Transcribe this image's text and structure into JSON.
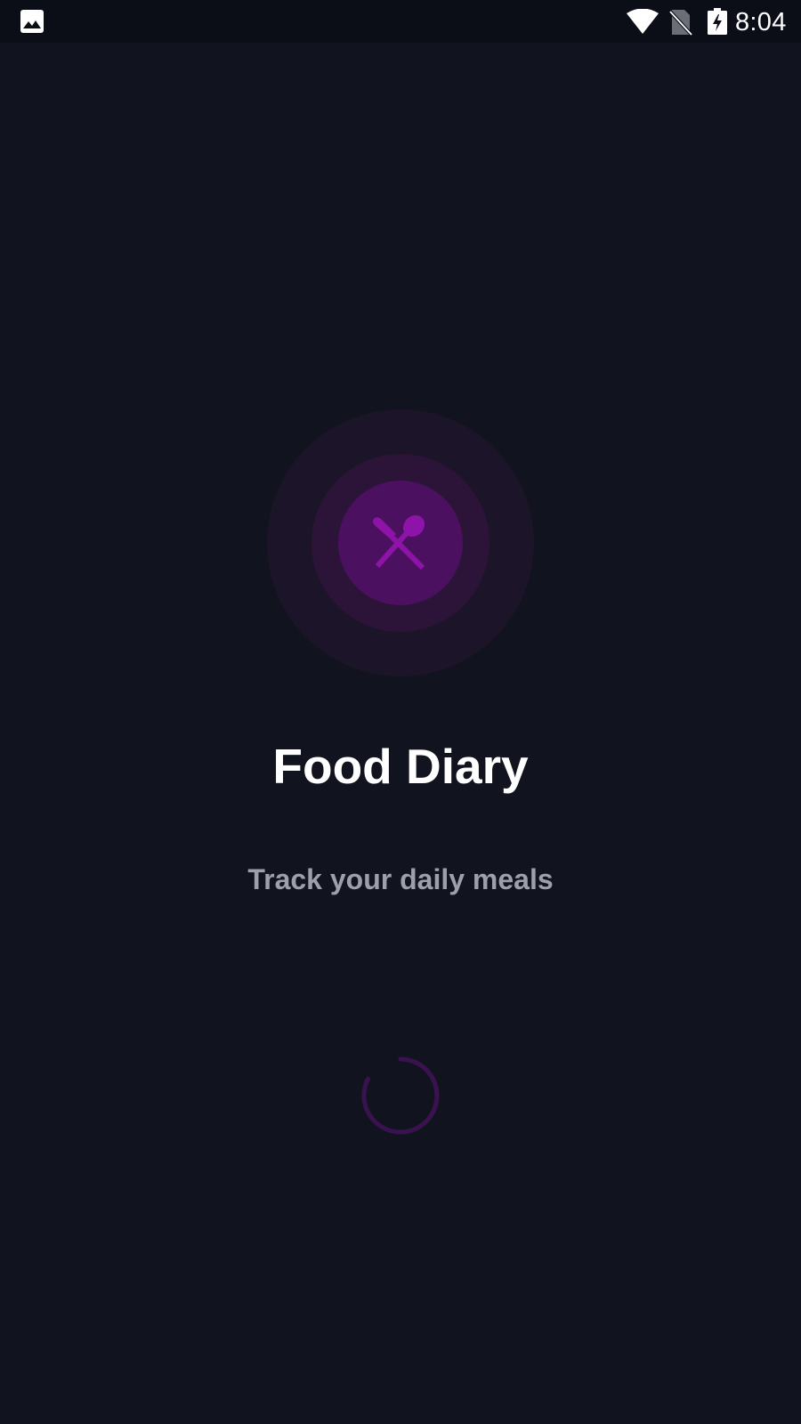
{
  "status_bar": {
    "time": "8:04",
    "icons": [
      "gallery-icon",
      "wifi-icon",
      "no-sim-icon",
      "battery-charging-icon"
    ]
  },
  "splash": {
    "logo_icon": "cutlery-icon",
    "title": "Food Diary",
    "subtitle": "Track your daily meals",
    "loading_indicator": "spinner"
  },
  "colors": {
    "background": "#11141e",
    "status_bar_bg": "#0b0e17",
    "accent": "#8e13a8",
    "ring_outer": "#1c1428",
    "ring_middle": "#2b1437",
    "ring_inner": "#4c1060",
    "title": "#ffffff",
    "subtitle": "#9da0a9"
  }
}
